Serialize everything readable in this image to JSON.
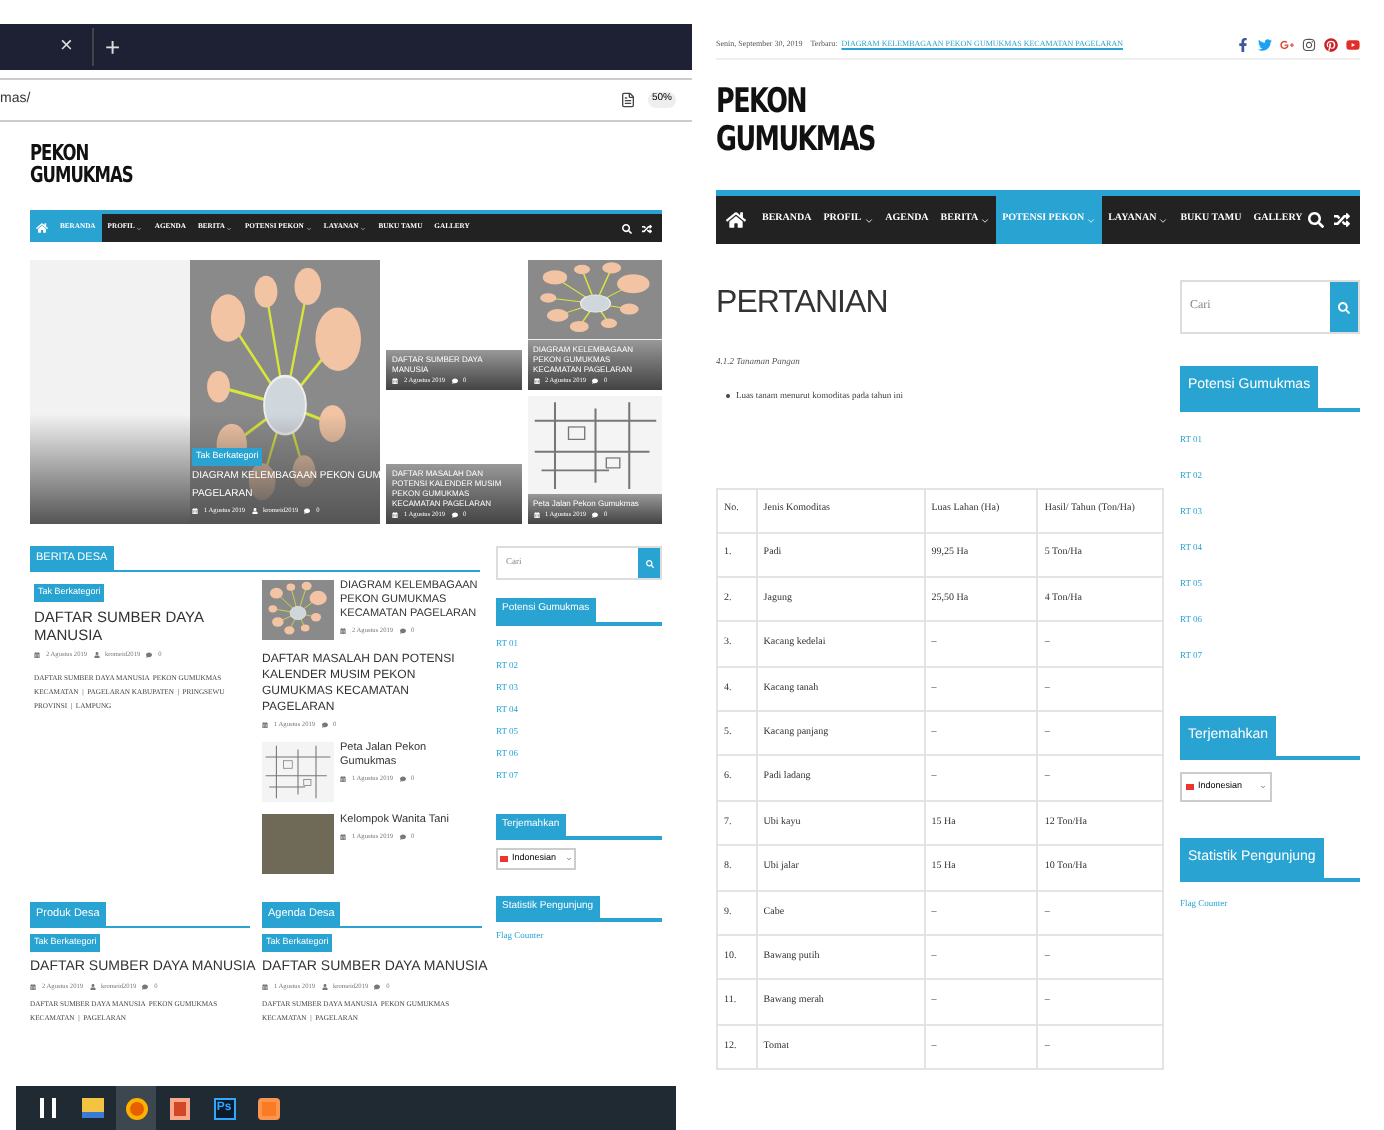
{
  "left": {
    "browser": {
      "tab_close": "×",
      "new_tab": "+",
      "address": "mas/",
      "zoom": "50%"
    },
    "logo": [
      "PEKON",
      "GUMUKMAS"
    ],
    "nav": [
      {
        "label": "BERANDA",
        "selected": true,
        "dropdown": false
      },
      {
        "label": "PROFIL",
        "selected": false,
        "dropdown": true
      },
      {
        "label": "AGENDA",
        "selected": false,
        "dropdown": false
      },
      {
        "label": "BERITA",
        "selected": false,
        "dropdown": true
      },
      {
        "label": "POTENSI PEKON",
        "selected": false,
        "dropdown": true
      },
      {
        "label": "LAYANAN",
        "selected": false,
        "dropdown": true
      },
      {
        "label": "BUKU TAMU",
        "selected": false,
        "dropdown": false
      },
      {
        "label": "GALLERY",
        "selected": false,
        "dropdown": false
      }
    ],
    "hero": {
      "badge": "Tak Berkategori",
      "title_lines": [
        "DIAGRAM KELEMBAGAAN PEKON GUM",
        "PAGELARAN"
      ],
      "date": "1 Agustus 2019",
      "author": "kromeid2019",
      "comments": "0",
      "tiles": [
        {
          "kind": "plain",
          "title": "DAFTAR SUMBER DAYA MANUSIA",
          "date": "2 Agustus 2019",
          "comments": "0"
        },
        {
          "kind": "diagram",
          "title": "DIAGRAM KELEMBAGAAN PEKON GUMUKMAS KECAMATAN PAGELARAN",
          "date": "2 Agustus 2019",
          "comments": "0"
        },
        {
          "kind": "plain",
          "title": "DAFTAR MASALAH DAN POTENSI KALENDER MUSIM PEKON GUMUKMAS KECAMATAN PAGELARAN",
          "date": "1 Agustus 2019",
          "comments": "0"
        },
        {
          "kind": "map",
          "title": "Peta Jalan Pekon Gumukmas",
          "date": "1 Agustus 2019",
          "comments": "0"
        }
      ]
    },
    "berita": {
      "heading": "BERITA DESA",
      "featured": {
        "badge": "Tak Berkategori",
        "title": "DAFTAR SUMBER DAYA MANUSIA",
        "date": "2 Agustus 2019",
        "author": "kromeid2019",
        "comments": "0",
        "excerpt": "DAFTAR SUMBER DAYA MANUSIA  PEKON GUMUKMAS KECAMATAN  |  PAGELARAN KABUPATEN  |  PRINGSEWU PROVINSI  |  LAMPUNG"
      },
      "list": [
        {
          "kind": "diagram",
          "title": "DIAGRAM KELEMBAGAAN PEKON GUMUKMAS KECAMATAN PAGELARAN",
          "date": "2 Agustus 2019",
          "comments": "0"
        },
        {
          "kind": "none",
          "title": "DAFTAR MASALAH DAN POTENSI KALENDER MUSIM PEKON GUMUKMAS KECAMATAN PAGELARAN",
          "date": "1 Agustus 2019",
          "comments": "0"
        },
        {
          "kind": "map",
          "title": "Peta Jalan Pekon Gumukmas",
          "date": "1 Agustus 2019",
          "comments": "0"
        },
        {
          "kind": "photo",
          "title": "Kelompok Wanita Tani",
          "date": "1 Agustus 2019",
          "comments": "0"
        }
      ]
    },
    "bottom": [
      {
        "heading": "Produk Desa",
        "badge": "Tak Berkategori",
        "title": "DAFTAR SUMBER DAYA MANUSIA",
        "date": "2 Agustus 2019",
        "author": "kromeid2019",
        "comments": "0",
        "excerpt": "DAFTAR SUMBER DAYA MANUSIA  PEKON GUMUKMAS KECAMATAN  |  PAGELARAN"
      },
      {
        "heading": "Agenda Desa",
        "badge": "Tak Berkategori",
        "title": "DAFTAR SUMBER DAYA MANUSIA",
        "date": "1 Agustus 2019",
        "author": "kromeid2019",
        "comments": "0",
        "excerpt": "DAFTAR SUMBER DAYA MANUSIA  PEKON GUMUKMAS KECAMATAN  |  PAGELARAN"
      }
    ],
    "sidebar": {
      "search_placeholder": "Cari",
      "potensi_heading": "Potensi Gumukmas",
      "rt": [
        "RT 01",
        "RT 02",
        "RT 03",
        "RT 04",
        "RT 05",
        "RT 06",
        "RT 07"
      ],
      "translate_heading": "Terjemahkan",
      "language": "Indonesian",
      "stats_heading": "Statistik Pengunjung",
      "counter": "Flag Counter"
    },
    "taskbar": [
      {
        "kind": "taskview",
        "selected": false
      },
      {
        "kind": "explorer",
        "selected": false
      },
      {
        "kind": "firefox",
        "selected": true
      },
      {
        "kind": "slides",
        "selected": false
      },
      {
        "kind": "photoshop",
        "label": "Ps",
        "selected": false
      },
      {
        "kind": "xampp",
        "selected": false
      }
    ]
  },
  "right": {
    "topbar": {
      "date": "Senin, September 30, 2019",
      "latest_label": "Terbaru:",
      "latest_link": "DIAGRAM KELEMBAGAAN PEKON GUMUKMAS KECAMATAN PAGELARAN"
    },
    "social": [
      {
        "kind": "facebook",
        "color": "#3b5998"
      },
      {
        "kind": "twitter",
        "color": "#1da1f2"
      },
      {
        "kind": "googleplus",
        "color": "#dd4b39"
      },
      {
        "kind": "instagram",
        "color": "#555555"
      },
      {
        "kind": "pinterest",
        "color": "#cb2027"
      },
      {
        "kind": "youtube",
        "color": "#e52d27"
      }
    ],
    "logo": [
      "PEKON",
      "GUMUKMAS"
    ],
    "nav": [
      {
        "label": "BERANDA",
        "selected": false,
        "dropdown": false
      },
      {
        "label": "PROFIL",
        "selected": false,
        "dropdown": true
      },
      {
        "label": "AGENDA",
        "selected": false,
        "dropdown": false
      },
      {
        "label": "BERITA",
        "selected": false,
        "dropdown": true
      },
      {
        "label": "POTENSI PEKON",
        "selected": true,
        "dropdown": true
      },
      {
        "label": "LAYANAN",
        "selected": false,
        "dropdown": true
      },
      {
        "label": "BUKU TAMU",
        "selected": false,
        "dropdown": false
      },
      {
        "label": "GALLERY",
        "selected": false,
        "dropdown": false
      }
    ],
    "title": "PERTANIAN",
    "subtitle": "4.1.2 Tanaman Pangan",
    "bullet": "Luas tanam menurut komoditas pada tahun ini",
    "table": {
      "columns": [
        "No.",
        "Jenis Komoditas",
        "Luas Lahan (Ha)",
        "Hasil/ Tahun (Ton/Ha)"
      ],
      "rows": [
        [
          "1.",
          "Padi",
          "99,25 Ha",
          "5 Ton/Ha"
        ],
        [
          "2.",
          "Jagung",
          "25,50 Ha",
          "4 Ton/Ha"
        ],
        [
          "3.",
          "Kacang kedelai",
          "–",
          "–"
        ],
        [
          "4.",
          "Kacang tanah",
          "–",
          "–"
        ],
        [
          "5.",
          "Kacang panjang",
          "–",
          "–"
        ],
        [
          "6.",
          "Padi ladang",
          "–",
          "–"
        ],
        [
          "7.",
          "Ubi kayu",
          "15 Ha",
          "12 Ton/Ha"
        ],
        [
          "8.",
          "Ubi jalar",
          "15 Ha",
          "10 Ton/Ha"
        ],
        [
          "9.",
          "Cabe",
          "–",
          "–"
        ],
        [
          "10.",
          "Bawang putih",
          "–",
          "–"
        ],
        [
          "11.",
          "Bawang merah",
          "–",
          "–"
        ],
        [
          "12.",
          "Tomat",
          "–",
          "–"
        ]
      ]
    },
    "sidebar": {
      "search_placeholder": "Cari",
      "potensi_heading": "Potensi Gumukmas",
      "rt": [
        "RT 01",
        "RT 02",
        "RT 03",
        "RT 04",
        "RT 05",
        "RT 06",
        "RT 07"
      ],
      "translate_heading": "Terjemahkan",
      "language": "Indonesian",
      "stats_heading": "Statistik Pengunjung",
      "counter": "Flag Counter"
    }
  }
}
